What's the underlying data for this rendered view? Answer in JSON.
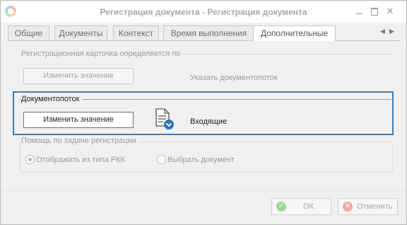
{
  "window": {
    "title": "Регистрация документа - Регистрация документа",
    "controls": {
      "minimize": "",
      "maximize": "",
      "close": "✕"
    }
  },
  "tabs": [
    {
      "label": "Общие"
    },
    {
      "label": "Документы"
    },
    {
      "label": "Контекст"
    },
    {
      "label": "Время выполнения"
    },
    {
      "label": "Дополнительные"
    }
  ],
  "tab_nav": {
    "prev": "◀",
    "next": "▶"
  },
  "active_tab": "Дополнительные",
  "registration_card": {
    "legend": "Регистрационная карточка определяется по",
    "change_button": "Изменить значение",
    "value_text": "Указать документопоток"
  },
  "document_flow": {
    "legend": "Документопоток",
    "change_button": "Изменить значение",
    "value_text": "Входящие",
    "icon": "document-flow-icon"
  },
  "registration_help": {
    "legend": "Помощь по задаче регистрации",
    "options": [
      {
        "label": "Отображать из типа РКК",
        "checked": true
      },
      {
        "label": "Выбрать документ",
        "checked": false
      }
    ]
  },
  "footer": {
    "ok_label": "ОК",
    "cancel_label": "Отменить",
    "ok_icon": "check-icon",
    "cancel_icon": "cancel-icon"
  },
  "colors": {
    "focus_border": "#3f7db0",
    "ok_icon": "#9fd59b",
    "cancel_icon": "#f0a7a7"
  }
}
